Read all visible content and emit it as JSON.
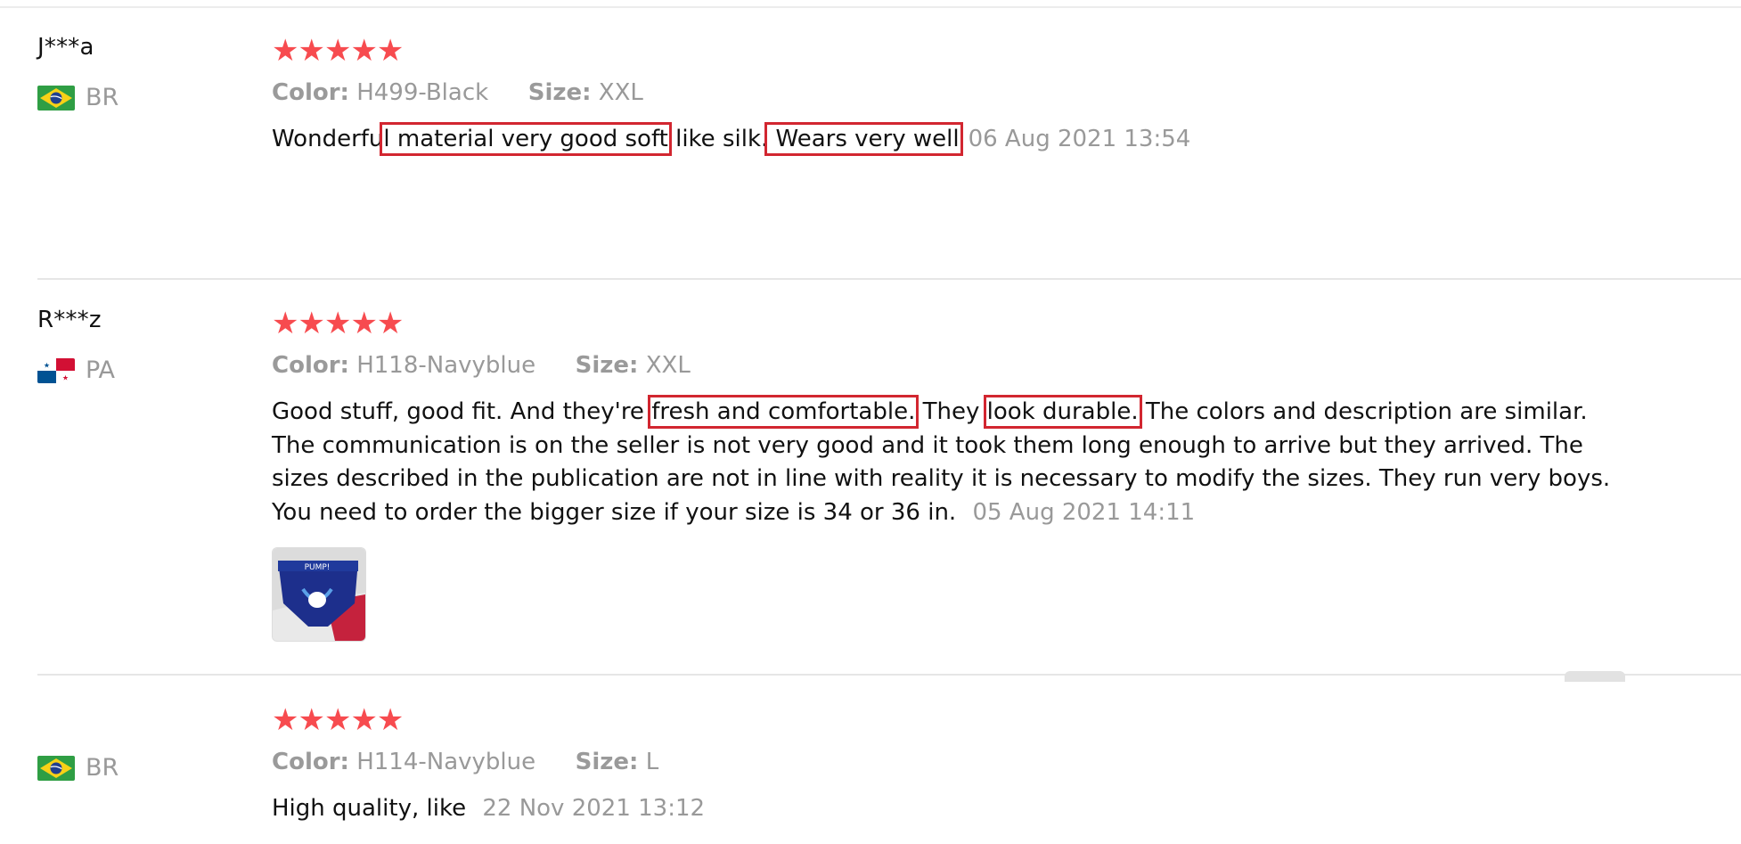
{
  "colors": {
    "star": "#f74b4f",
    "highlight_box": "#d22630",
    "muted_text": "#999999"
  },
  "reviews": [
    {
      "user": "J***a",
      "country": "BR",
      "flag": "brazil-flag",
      "stars": "★★★★★",
      "rating": 5,
      "color_label": "Color:",
      "color_value": "H499-Black",
      "size_label": "Size:",
      "size_value": "XXL",
      "text_parts": [
        "Wonderfu",
        "l material very good soft",
        " like silk.",
        " Wears very well",
        ""
      ],
      "date": "06 Aug 2021 13:54"
    },
    {
      "user": "R***z",
      "country": "PA",
      "flag": "panama-flag",
      "stars": "★★★★★",
      "rating": 5,
      "color_label": "Color:",
      "color_value": "H118-Navyblue",
      "size_label": "Size:",
      "size_value": "XXL",
      "text_parts": [
        "Good stuff, good fit. And they're ",
        "fresh and comfortable.",
        " They ",
        "look durable.",
        " The colors and description are similar. The communication is on the seller is not very good and it took them long enough to arrive but they arrived. The sizes described in the publication are not in line with reality it is necessary to modify the sizes. They run very boys. You need to order the bigger size if your size is 34 or 36 in. "
      ],
      "date": "05 Aug 2021 14:11",
      "photo": "underwear-photo"
    },
    {
      "user": "",
      "country": "BR",
      "flag": "brazil-flag",
      "stars": "★★★★★",
      "rating": 5,
      "color_label": "Color:",
      "color_value": "H114-Navyblue",
      "size_label": "Size:",
      "size_value": "L",
      "text_parts": [
        "High quality, like "
      ],
      "date": "22 Nov 2021 13:12"
    }
  ]
}
